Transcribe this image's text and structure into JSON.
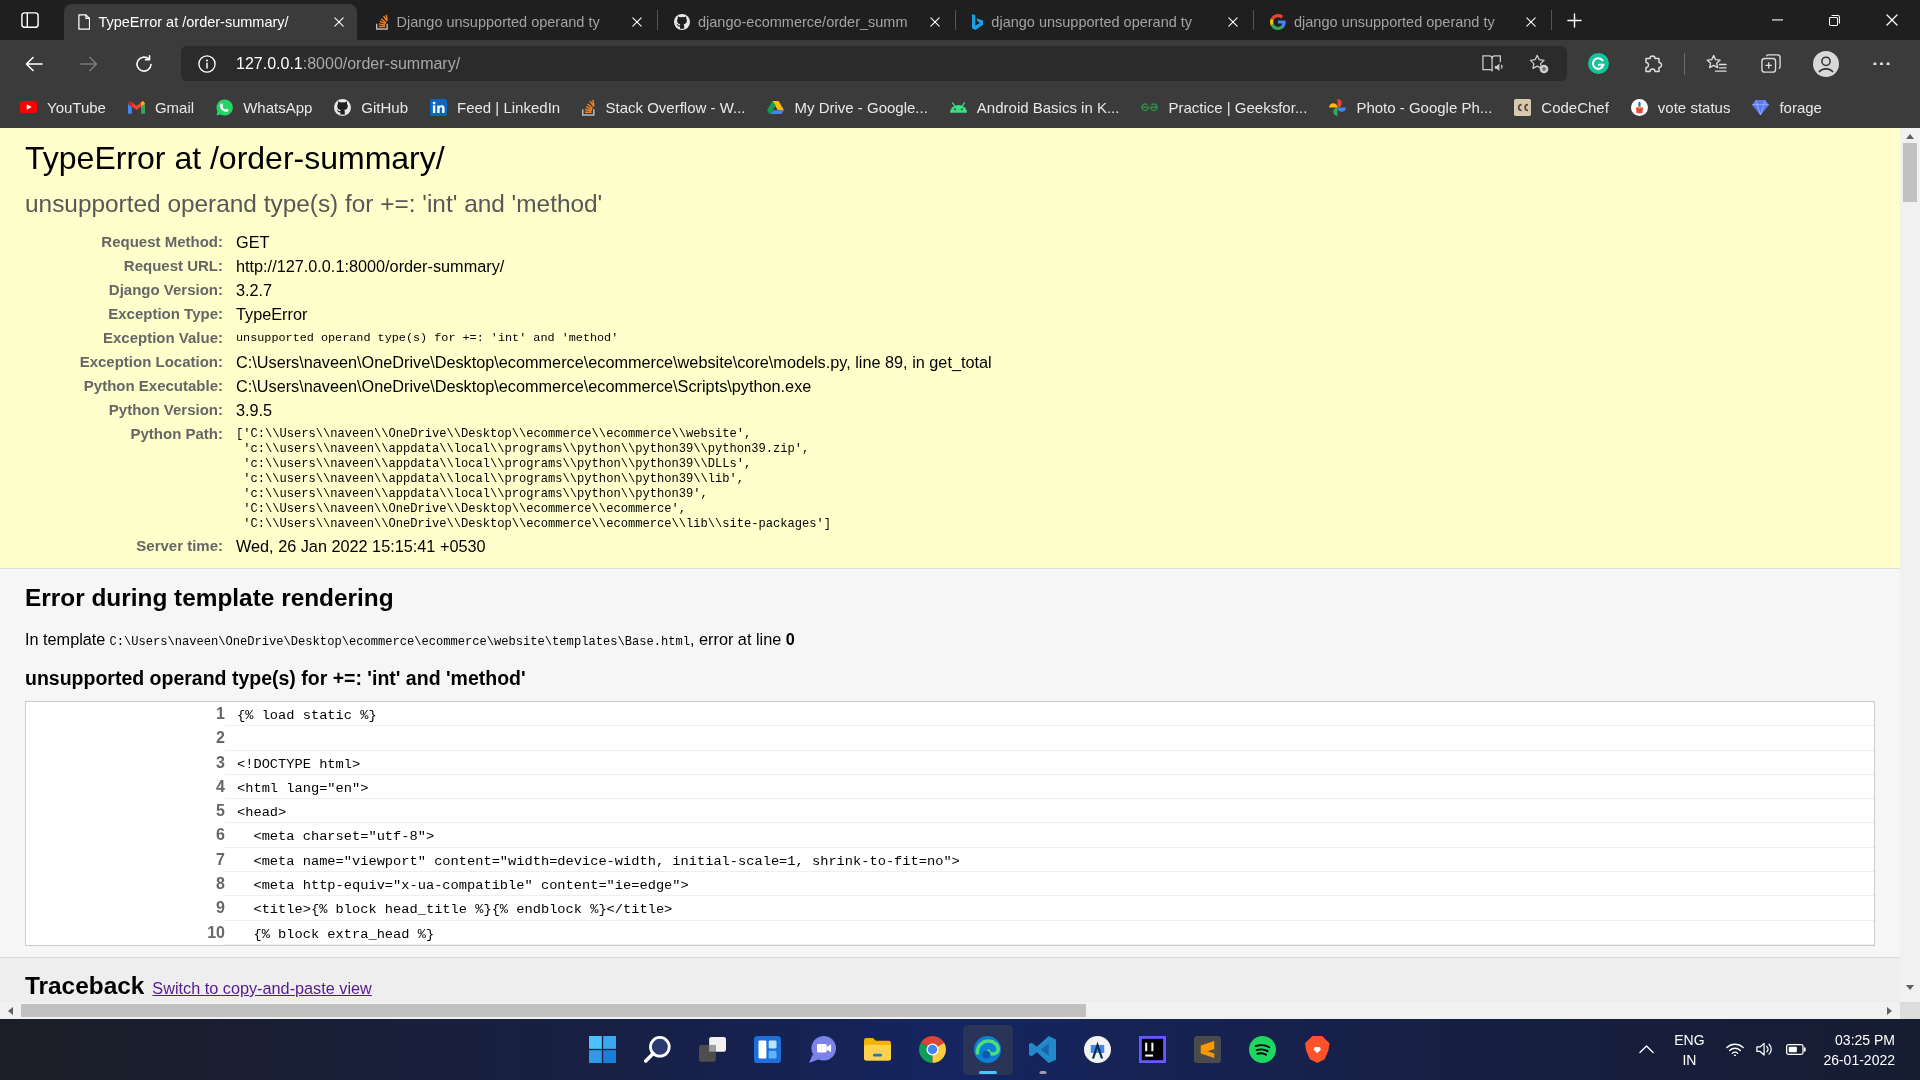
{
  "browser": {
    "tabs": [
      {
        "kind": "page",
        "title": "TypeError at /order-summary/",
        "selected": true
      },
      {
        "kind": "stackoverflow",
        "title": "Django unsupported operand ty",
        "selected": false
      },
      {
        "kind": "github",
        "title": "django-ecommerce/order_summ",
        "selected": false
      },
      {
        "kind": "bing",
        "title": "django unsupported operand ty",
        "selected": false
      },
      {
        "kind": "google",
        "title": "django unsupported operand ty",
        "selected": false
      }
    ],
    "nav_buttons": [
      {
        "kind": "back",
        "disabled": false
      },
      {
        "kind": "forward",
        "disabled": true
      },
      {
        "kind": "refresh",
        "disabled": false
      }
    ],
    "address_bar": {
      "host": "127.0.0.1",
      "rest": ":8000/order-summary/"
    },
    "bookmarks": [
      {
        "kind": "youtube",
        "label": "YouTube"
      },
      {
        "kind": "gmail",
        "label": "Gmail"
      },
      {
        "kind": "whatsapp",
        "label": "WhatsApp"
      },
      {
        "kind": "github",
        "label": "GitHub"
      },
      {
        "kind": "linkedin",
        "label": "Feed | LinkedIn"
      },
      {
        "kind": "stackoverflow",
        "label": "Stack Overflow - W..."
      },
      {
        "kind": "drive",
        "label": "My Drive - Google..."
      },
      {
        "kind": "android",
        "label": "Android Basics in K..."
      },
      {
        "kind": "geeksforgeeks",
        "label": "Practice | Geeksfor..."
      },
      {
        "kind": "photos",
        "label": "Photo - Google Ph..."
      },
      {
        "kind": "codechef",
        "label": "CodeChef"
      },
      {
        "kind": "vote",
        "label": "vote status"
      },
      {
        "kind": "forage",
        "label": "forage"
      }
    ]
  },
  "page": {
    "title": "TypeError at /order-summary/",
    "exception_value": "unsupported operand type(s) for +=: 'int' and 'method'",
    "meta": [
      {
        "kind": "text",
        "label": "Request Method:",
        "value": "GET"
      },
      {
        "kind": "text",
        "label": "Request URL:",
        "value": "http://127.0.0.1:8000/order-summary/"
      },
      {
        "kind": "text",
        "label": "Django Version:",
        "value": "3.2.7"
      },
      {
        "kind": "text",
        "label": "Exception Type:",
        "value": "TypeError"
      },
      {
        "kind": "code",
        "label": "Exception Value:",
        "value": "unsupported operand type(s) for +=: 'int' and 'method'"
      },
      {
        "kind": "text",
        "label": "Exception Location:",
        "value": "C:\\Users\\naveen\\OneDrive\\Desktop\\ecommerce\\ecommerce\\website\\core\\models.py, line 89, in get_total"
      },
      {
        "kind": "text",
        "label": "Python Executable:",
        "value": "C:\\Users\\naveen\\OneDrive\\Desktop\\ecommerce\\ecommerce\\Scripts\\python.exe"
      },
      {
        "kind": "text",
        "label": "Python Version:",
        "value": "3.9.5"
      },
      {
        "kind": "lines",
        "label": "Python Path:",
        "lines": [
          "['C:\\\\Users\\\\naveen\\\\OneDrive\\\\Desktop\\\\ecommerce\\\\ecommerce\\\\website',",
          " 'c:\\\\users\\\\naveen\\\\appdata\\\\local\\\\programs\\\\python\\\\python39\\\\python39.zip',",
          " 'c:\\\\users\\\\naveen\\\\appdata\\\\local\\\\programs\\\\python\\\\python39\\\\DLLs',",
          " 'c:\\\\users\\\\naveen\\\\appdata\\\\local\\\\programs\\\\python\\\\python39\\\\lib',",
          " 'c:\\\\users\\\\naveen\\\\appdata\\\\local\\\\programs\\\\python\\\\python39',",
          " 'C:\\\\Users\\\\naveen\\\\OneDrive\\\\Desktop\\\\ecommerce\\\\ecommerce',",
          " 'C:\\\\Users\\\\naveen\\\\OneDrive\\\\Desktop\\\\ecommerce\\\\ecommerce\\\\lib\\\\site-packages']"
        ]
      },
      {
        "kind": "text",
        "label": "Server time:",
        "value": "Wed, 26 Jan 2022 15:15:41 +0530"
      }
    ],
    "template_error": {
      "heading": "Error during template rendering",
      "intro": "In template",
      "path": "C:\\Users\\naveen\\OneDrive\\Desktop\\ecommerce\\ecommerce\\website\\templates\\Base.html",
      "suffix": ", error at line **0**",
      "message": "unsupported operand type(s) for +=: 'int' and 'method'",
      "source_lines": [
        {
          "number": "1",
          "code": "{% load static %}"
        },
        {
          "number": "2"
        },
        {
          "number": "3",
          "code": "<!DOCTYPE html>"
        },
        {
          "number": "4",
          "code": "<html lang=\"en\">"
        },
        {
          "number": "5",
          "code": "<head>"
        },
        {
          "number": "6",
          "code": "  <meta charset=\"utf-8\">"
        },
        {
          "number": "7",
          "code": "  <meta name=\"viewport\" content=\"width=device-width, initial-scale=1, shrink-to-fit=no\">"
        },
        {
          "number": "8",
          "code": "  <meta http-equiv=\"x-ua-compatible\" content=\"ie=edge\">"
        },
        {
          "number": "9",
          "code": "  <title>{% block head_title %}{% endblock %}</title>"
        },
        {
          "number": "10",
          "code": "  {% block extra_head %}"
        }
      ]
    },
    "traceback": {
      "heading": "Traceback",
      "link": "Switch to copy-and-paste view"
    }
  },
  "taskbar": {
    "apps": [
      {
        "kind": "start",
        "active": false,
        "running": false
      },
      {
        "kind": "search",
        "active": false,
        "running": false
      },
      {
        "kind": "taskview",
        "active": false,
        "running": false
      },
      {
        "kind": "widgets",
        "active": false,
        "running": false
      },
      {
        "kind": "chat",
        "active": false,
        "running": false
      },
      {
        "kind": "explorer",
        "active": false,
        "running": false
      },
      {
        "kind": "chrome",
        "active": false,
        "running": false
      },
      {
        "kind": "edge",
        "active": true,
        "running": true
      },
      {
        "kind": "vscode",
        "active": false,
        "running": true
      },
      {
        "kind": "androidstudio",
        "active": false,
        "running": false
      },
      {
        "kind": "intellij",
        "active": false,
        "running": false
      },
      {
        "kind": "sublime",
        "active": false,
        "running": false
      },
      {
        "kind": "spotify",
        "active": false,
        "running": false
      },
      {
        "kind": "brave",
        "active": false,
        "running": false
      }
    ],
    "tray": {
      "language": "ENG",
      "region": "IN",
      "time": "03:25 PM",
      "date": "26-01-2022"
    }
  }
}
